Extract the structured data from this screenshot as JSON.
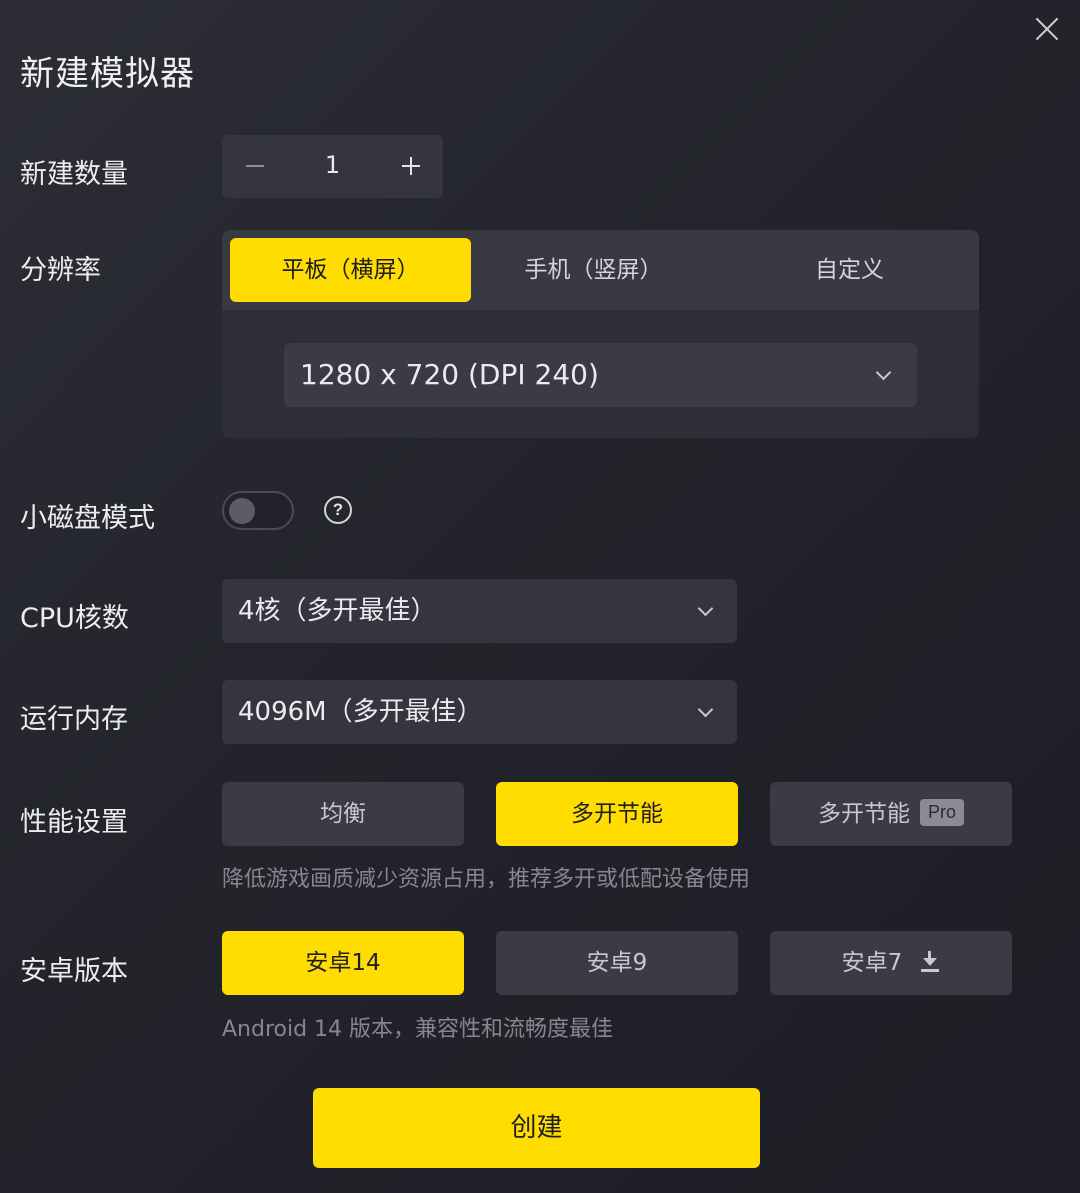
{
  "dialog": {
    "title": "新建模拟器",
    "close_icon": "close-icon"
  },
  "count": {
    "label": "新建数量",
    "value": "1",
    "minus_icon": "minus-icon",
    "plus_icon": "plus-icon"
  },
  "resolution": {
    "label": "分辨率",
    "tabs": [
      {
        "label": "平板（横屏）",
        "active": true
      },
      {
        "label": "手机（竖屏）",
        "active": false
      },
      {
        "label": "自定义",
        "active": false
      }
    ],
    "selected": "1280 x 720 (DPI 240)"
  },
  "small_disk": {
    "label": "小磁盘模式",
    "enabled": false,
    "help_glyph": "?"
  },
  "cpu": {
    "label": "CPU核数",
    "selected": "4核（多开最佳）"
  },
  "memory": {
    "label": "运行内存",
    "selected": "4096M（多开最佳）"
  },
  "performance": {
    "label": "性能设置",
    "options": [
      {
        "label": "均衡",
        "active": false
      },
      {
        "label": "多开节能",
        "active": true
      },
      {
        "label": "多开节能",
        "badge": "Pro",
        "active": false
      }
    ],
    "hint": "降低游戏画质减少资源占用，推荐多开或低配设备使用"
  },
  "android": {
    "label": "安卓版本",
    "options": [
      {
        "label": "安卓14",
        "active": true
      },
      {
        "label": "安卓9",
        "active": false
      },
      {
        "label": "安卓7",
        "icon": "download-icon",
        "active": false
      }
    ],
    "hint": "Android 14 版本，兼容性和流畅度最佳"
  },
  "create_button": "创建",
  "colors": {
    "accent": "#ffdd00",
    "background": "#23242b",
    "control": "#34353f",
    "hint_text": "#85868f"
  }
}
